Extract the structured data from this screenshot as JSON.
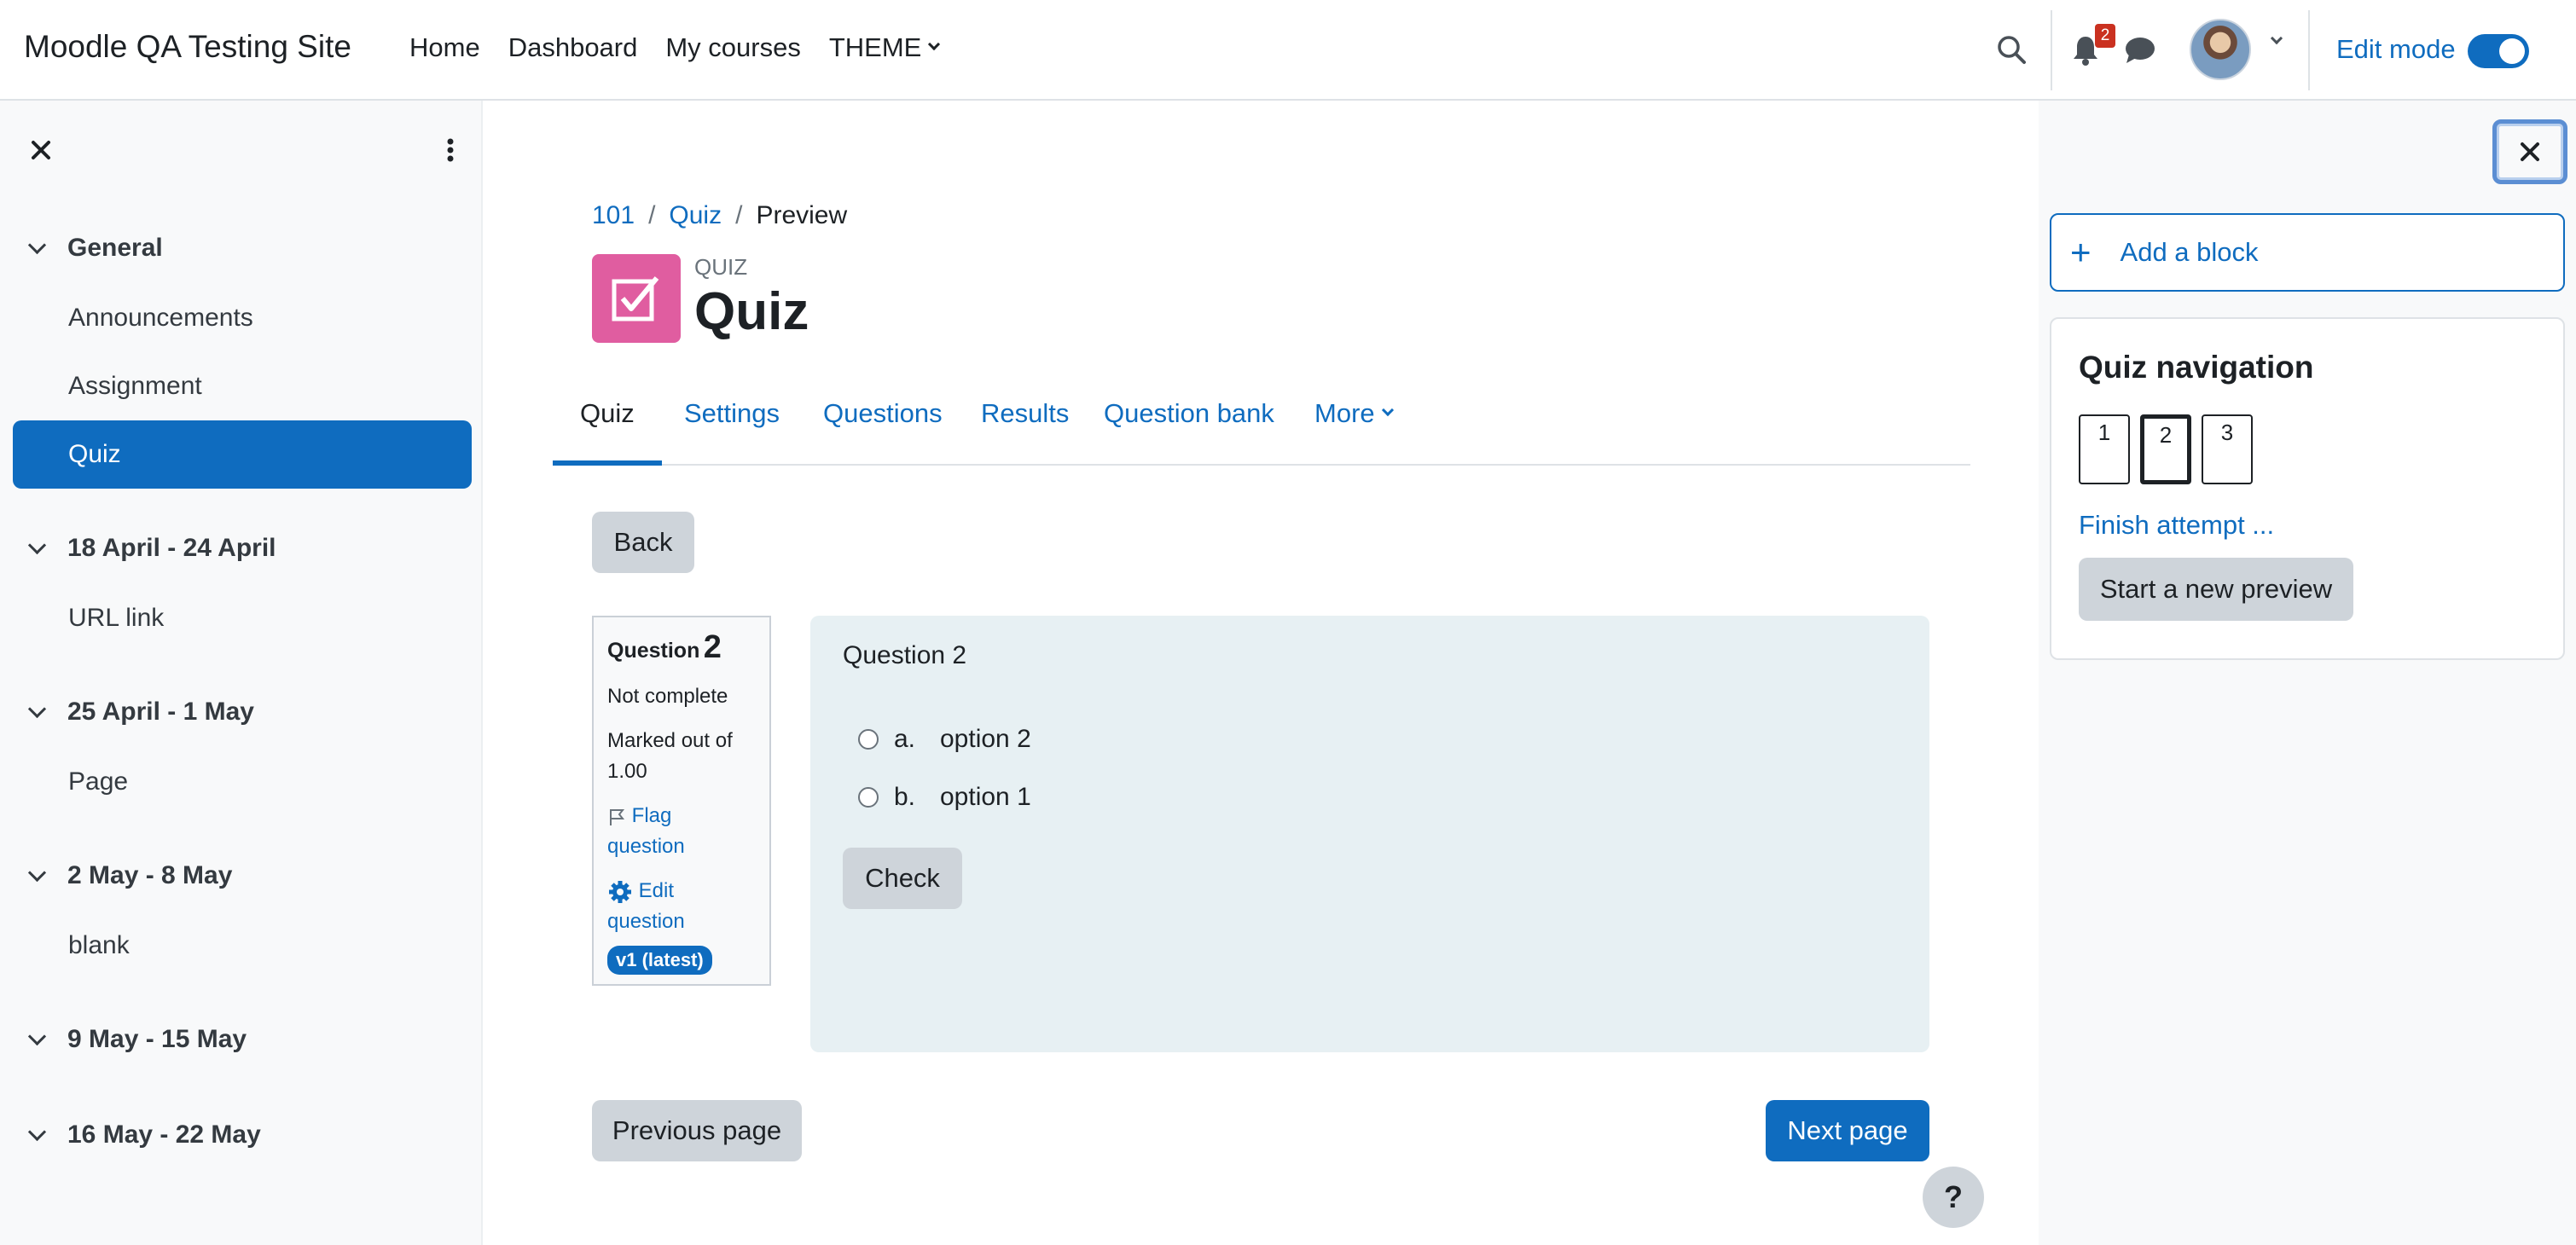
{
  "navbar": {
    "site_name": "Moodle QA Testing Site",
    "links": [
      "Home",
      "Dashboard",
      "My courses"
    ],
    "theme_label": "THEME",
    "notification_count": "2",
    "edit_mode_label": "Edit mode",
    "edit_mode_on": true,
    "accent": "#0f6cbf"
  },
  "course_index": {
    "sections": [
      {
        "title": "General",
        "items": [
          "Announcements",
          "Assignment",
          "Quiz"
        ]
      },
      {
        "title": "18 April - 24 April",
        "items": [
          "URL link"
        ]
      },
      {
        "title": "25 April - 1 May",
        "items": [
          "Page"
        ]
      },
      {
        "title": "2 May - 8 May",
        "items": [
          "blank"
        ]
      },
      {
        "title": "9 May - 15 May",
        "items": []
      },
      {
        "title": "16 May - 22 May",
        "items": []
      }
    ],
    "active_item": "Quiz"
  },
  "breadcrumb": [
    "101",
    "Quiz",
    "Preview"
  ],
  "header": {
    "module_label": "QUIZ",
    "title": "Quiz",
    "icon": "quiz-checkbox-icon",
    "icon_color": "#e05da0"
  },
  "tabs": [
    "Quiz",
    "Settings",
    "Questions",
    "Results",
    "Question bank",
    "More"
  ],
  "active_tab": "Quiz",
  "back_label": "Back",
  "question_info": {
    "label": "Question",
    "number": "2",
    "state": "Not complete",
    "grade_line1": "Marked out of",
    "grade_line2": "1.00",
    "flag_line1": "Flag",
    "flag_line2": "question",
    "edit_line1": "Edit",
    "edit_line2": "question",
    "version": "v1 (latest)"
  },
  "question": {
    "text": "Question 2",
    "answers": [
      {
        "letter": "a.",
        "text": "option 2"
      },
      {
        "letter": "b.",
        "text": "option 1"
      }
    ],
    "check_label": "Check"
  },
  "paging": {
    "previous_label": "Previous page",
    "next_label": "Next page"
  },
  "help_label": "?",
  "right_drawer": {
    "add_block_label": "Add a block",
    "quiz_nav_title": "Quiz navigation",
    "question_buttons": [
      "1",
      "2",
      "3"
    ],
    "current_question": "2",
    "finish_label": "Finish attempt ...",
    "new_preview_label": "Start a new preview"
  }
}
